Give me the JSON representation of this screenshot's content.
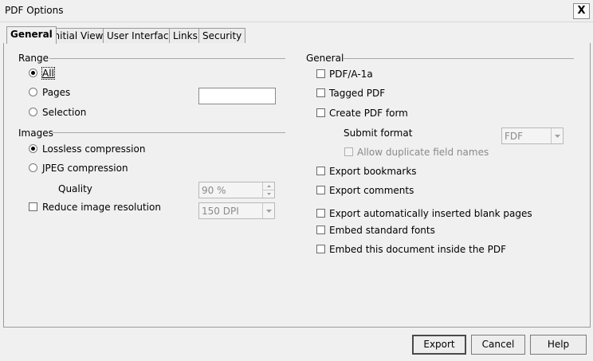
{
  "window": {
    "title": "PDF Options",
    "close_glyph": "X"
  },
  "tabs": [
    "General",
    "Initial View",
    "User Interface",
    "Links",
    "Security"
  ],
  "range": {
    "heading": "Range",
    "all": "All",
    "pages": "Pages",
    "pages_value": "",
    "selection": "Selection",
    "selected": "All"
  },
  "images": {
    "heading": "Images",
    "lossless": "Lossless compression",
    "jpeg": "JPEG compression",
    "quality_label": "Quality",
    "quality_value": "90 %",
    "reduce_label": "Reduce image resolution",
    "resolution_value": "150 DPI",
    "selected": "Lossless compression"
  },
  "general": {
    "heading": "General",
    "pdfa": "PDF/A-1a",
    "tagged": "Tagged PDF",
    "create_form": "Create PDF form",
    "submit_format_label": "Submit format",
    "submit_format_value": "FDF",
    "allow_duplicate": "Allow duplicate field names",
    "export_bookmarks": "Export bookmarks",
    "export_comments": "Export comments",
    "export_blank_pages": "Export automatically inserted blank pages",
    "embed_fonts": "Embed standard fonts",
    "embed_document": "Embed this document inside the PDF"
  },
  "buttons": {
    "export": "Export",
    "cancel": "Cancel",
    "help": "Help"
  },
  "icons": {
    "close": "close-icon",
    "radio": "radio-icon",
    "checkbox": "checkbox-icon",
    "dropdown": "chevron-down-icon"
  }
}
